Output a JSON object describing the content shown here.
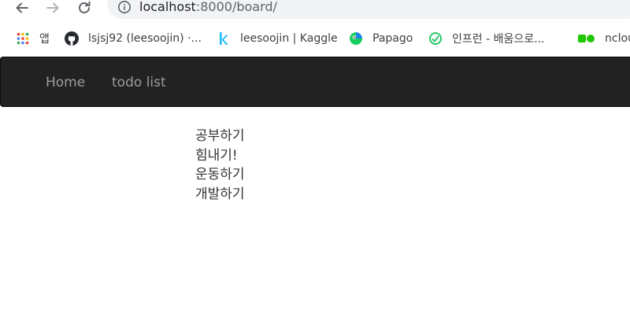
{
  "browser": {
    "url_host": "localhost",
    "url_rest": ":8000/board/"
  },
  "bookmarks": [
    {
      "icon": "apps-icon",
      "label": "앱"
    },
    {
      "icon": "github-icon",
      "label": "lsjsj92 (leesoojin) ·..."
    },
    {
      "icon": "kaggle-icon",
      "label": "leesoojin | Kaggle"
    },
    {
      "icon": "papago-icon",
      "label": "Papago"
    },
    {
      "icon": "inflearn-icon",
      "label": "인프런 - 배움으로..."
    },
    {
      "icon": "ncloud-icon",
      "label": "nclou"
    }
  ],
  "navbar": {
    "home_label": "Home",
    "todo_label": "todo list"
  },
  "todos": [
    "공부하기",
    "힘내기!",
    "운동하기",
    "개발하기"
  ]
}
